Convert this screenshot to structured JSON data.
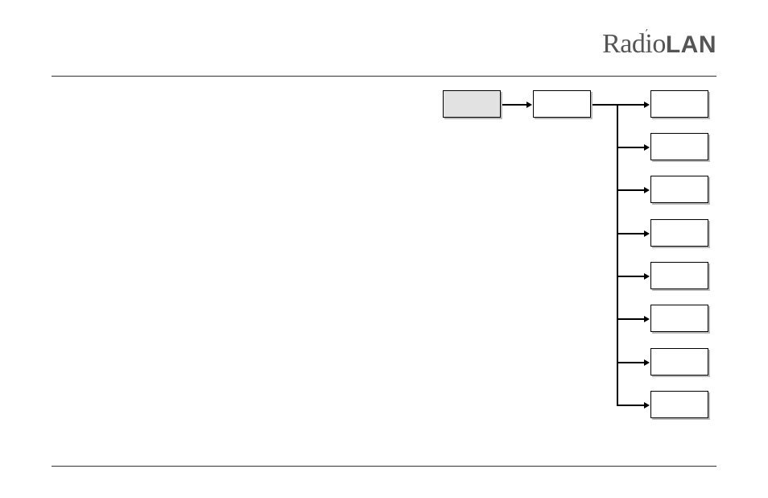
{
  "logo": {
    "part1": "Radio",
    "part2": "LAN",
    "accent": "′"
  },
  "diagram": {
    "root": {
      "shaded": true
    },
    "level2": {
      "shaded": false
    },
    "leaves": [
      {},
      {},
      {},
      {},
      {},
      {},
      {},
      {}
    ]
  }
}
